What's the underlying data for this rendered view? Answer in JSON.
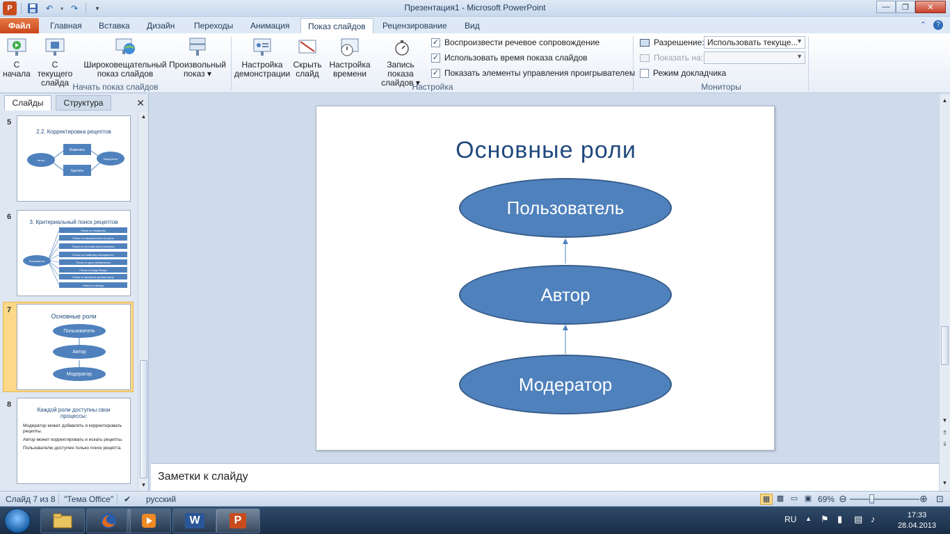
{
  "window": {
    "title": "Презентация1  -  Microsoft PowerPoint",
    "app_icon": "P"
  },
  "tabs": [
    "Главная",
    "Вставка",
    "Дизайн",
    "Переходы",
    "Анимация",
    "Показ слайдов",
    "Рецензирование",
    "Вид"
  ],
  "file_tab": "Файл",
  "active_tab": "Показ слайдов",
  "ribbon": {
    "start_group": {
      "label": "Начать показ слайдов",
      "from_start": "С\nначала",
      "from_current": "С текущего\nслайда",
      "broadcast": "Широковещательный\nпоказ слайдов",
      "custom": "Произвольный\nпоказ ▾"
    },
    "setup_group": {
      "label": "Настройка",
      "setup": "Настройка\nдемонстрации",
      "hide": "Скрыть\nслайд",
      "rehearse": "Настройка\nвремени",
      "record": "Запись показа\nслайдов ▾",
      "chk_narration": "Воспроизвести речевое сопровождение",
      "chk_timings": "Использовать время показа слайдов",
      "chk_controls": "Показать элементы управления проигрывателем"
    },
    "monitors_group": {
      "label": "Мониторы",
      "resolution_label": "Разрешение:",
      "resolution_value": "Использовать текуще...",
      "show_on_label": "Показать на:",
      "presenter_view": "Режим докладчика"
    }
  },
  "left_pane": {
    "tab_slides": "Слайды",
    "tab_outline": "Структура",
    "thumbnails": [
      {
        "num": "5",
        "title": "2.2. Корректировка рецептов",
        "labels": [
          "Изменить",
          "Удалить",
          "Автор",
          "Модератор"
        ]
      },
      {
        "num": "6",
        "title": "3. Критериальный поиск рецептов",
        "labels": [
          "Пользователь",
          "Поиск по названию",
          "Поиск по национальности  кухни",
          "Поиск по способу приготовления",
          "Поиск по главному ингредиенту",
          "Поиск по дате добавления",
          "Поиск по виду блюда",
          "Поиск по времени приема пищи",
          "Поиск по автору"
        ]
      },
      {
        "num": "7",
        "title": "Основные роли",
        "labels": [
          "Пользователь",
          "Автор",
          "Модератор"
        ]
      },
      {
        "num": "8",
        "title": "Каждой роли доступны свои процессы:",
        "labels": [
          "Модератор может добавлять и корректировать рецепты.",
          "Автор может корректировать и искать рецепты.",
          "Пользователю доступен только поиск рецепта."
        ]
      }
    ]
  },
  "slide": {
    "title": "Основные роли",
    "roles": [
      "Пользователь",
      "Автор",
      "Модератор"
    ]
  },
  "notes_placeholder": "Заметки к слайду",
  "status": {
    "slide_info": "Слайд 7 из 8",
    "theme": "\"Тема Office\"",
    "language": "русский",
    "zoom": "69%"
  },
  "taskbar": {
    "lang": "RU",
    "time": "17:33",
    "date": "28.04.2013"
  },
  "colors": {
    "role_fill": "#4f81bd",
    "title_color": "#1f497d",
    "file_tab": "#c9461a"
  }
}
